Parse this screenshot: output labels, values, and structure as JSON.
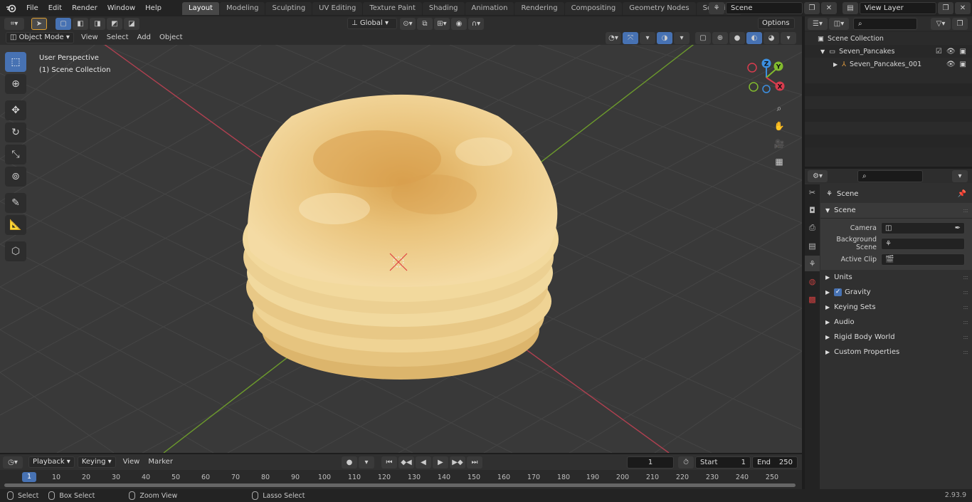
{
  "topbar": {
    "menus": [
      "File",
      "Edit",
      "Render",
      "Window",
      "Help"
    ],
    "workspaces": [
      "Layout",
      "Modeling",
      "Sculpting",
      "UV Editing",
      "Texture Paint",
      "Shading",
      "Animation",
      "Rendering",
      "Compositing",
      "Geometry Nodes",
      "Scripting"
    ],
    "active_workspace": "Layout",
    "scene": "Scene",
    "view_layer": "View Layer"
  },
  "viewport": {
    "mode": "Object Mode",
    "menus": [
      "View",
      "Select",
      "Add",
      "Object"
    ],
    "transform_orientation": "Global",
    "options_label": "Options",
    "perspective_label": "User Perspective",
    "collection_label": "(1) Scene Collection",
    "gizmo_axes": {
      "x": "X",
      "y": "Y",
      "z": "Z"
    }
  },
  "outliner": {
    "root": "Scene Collection",
    "collection": "Seven_Pancakes",
    "object": "Seven_Pancakes_001"
  },
  "properties": {
    "title": "Scene",
    "panel": "Scene",
    "rows": [
      {
        "label": "Camera"
      },
      {
        "label": "Background Scene"
      },
      {
        "label": "Active Clip"
      }
    ],
    "subpanels": [
      "Units",
      "Gravity",
      "Keying Sets",
      "Audio",
      "Rigid Body World",
      "Custom Properties"
    ]
  },
  "timeline": {
    "menus": [
      "Playback",
      "Keying",
      "View",
      "Marker"
    ],
    "current_frame": "1",
    "start_label": "Start",
    "start": "1",
    "end_label": "End",
    "end": "250",
    "ruler": [
      "10",
      "20",
      "30",
      "40",
      "50",
      "60",
      "70",
      "80",
      "90",
      "100",
      "110",
      "120",
      "130",
      "140",
      "150",
      "160",
      "170",
      "180",
      "190",
      "200",
      "210",
      "220",
      "230",
      "240",
      "250"
    ],
    "ruler_current": "1"
  },
  "statusbar": {
    "select": "Select",
    "box_select": "Box Select",
    "zoom_view": "Zoom View",
    "lasso_select": "Lasso Select",
    "version": "2.93.9"
  },
  "colors": {
    "accent": "#4772b3",
    "x_axis": "#d83c4e",
    "y_axis": "#82bb2e",
    "z_axis": "#3c8fe0"
  }
}
